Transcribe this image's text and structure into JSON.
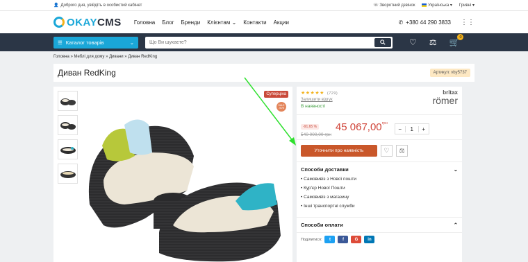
{
  "topbar": {
    "greeting": "Доброго дня, увійдіть в особистий кабінет",
    "callback": "Зворотний дзвінок",
    "language": "Українська",
    "currency": "Гривні"
  },
  "header": {
    "logo_a": "OKAY",
    "logo_b": "CMS",
    "nav": [
      "Головна",
      "Блог",
      "Бренди",
      "Клієнтам",
      "Контакти",
      "Акции"
    ],
    "phone": "+380 44 290 3833"
  },
  "search": {
    "catalog_label": "Каталог товарів",
    "placeholder": "Що Ви шукаєте?",
    "cart_count": "0"
  },
  "breadcrumb": [
    "Головна",
    "Меблі для дому",
    "Дивани",
    "Диван RedKing"
  ],
  "product": {
    "title": "Диван RedKing",
    "sku": "Артикул: vby5737",
    "badge_hit": "Суперціна",
    "badge_disc": "SALE -91%",
    "rating_stars": "★★★★★",
    "rating_count": "(729)",
    "review_link": "Залишити відгук",
    "stock": "В наявності",
    "brand_top": "britax",
    "brand_bottom": "römer",
    "discount": "-91,65 %",
    "old_price": "540 000,00 грн",
    "price": "45 067,00",
    "currency": "грн",
    "qty": "1",
    "buy_label": "Уточнити про наявність"
  },
  "delivery": {
    "title": "Способи доставки",
    "items": [
      "Самовивіз з Нової пошти",
      "Кур'єр Нової Пошти",
      "Самовивіз з магазину",
      "Інші транспортні служби"
    ]
  },
  "payment": {
    "title": "Способи оплати"
  },
  "share": {
    "label": "Поділитися:"
  },
  "colors": {
    "accent": "#1aa7d8",
    "dark": "#2b3646",
    "buy": "#c9572a",
    "price": "#d0453a",
    "stock": "#3e9d3e",
    "star": "#f3b21b"
  }
}
